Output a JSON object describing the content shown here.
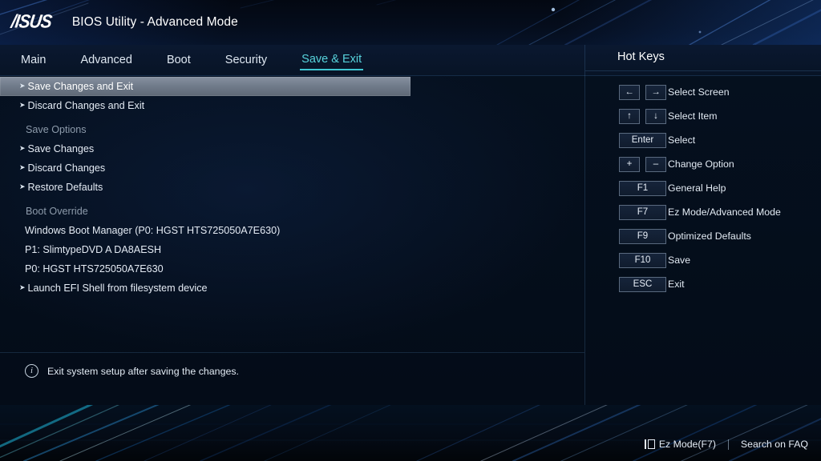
{
  "header": {
    "logo": "/ISUS",
    "title": "BIOS Utility - Advanced Mode"
  },
  "nav": {
    "items": [
      {
        "label": "Main",
        "active": false
      },
      {
        "label": "Advanced",
        "active": false
      },
      {
        "label": "Boot",
        "active": false
      },
      {
        "label": "Security",
        "active": false
      },
      {
        "label": "Save & Exit",
        "active": true
      }
    ]
  },
  "menu": {
    "rows": [
      {
        "label": "Save Changes and Exit",
        "type": "arrow",
        "selected": true
      },
      {
        "label": "Discard Changes and Exit",
        "type": "arrow",
        "selected": false
      },
      {
        "label": "Save Options",
        "type": "section",
        "selected": false
      },
      {
        "label": "Save Changes",
        "type": "arrow",
        "selected": false
      },
      {
        "label": "Discard Changes",
        "type": "arrow",
        "selected": false
      },
      {
        "label": "Restore Defaults",
        "type": "arrow",
        "selected": false
      },
      {
        "label": "Boot Override",
        "type": "section",
        "selected": false
      },
      {
        "label": "Windows Boot Manager (P0: HGST HTS725050A7E630)",
        "type": "plain",
        "selected": false
      },
      {
        "label": "P1: SlimtypeDVD A  DA8AESH",
        "type": "plain",
        "selected": false
      },
      {
        "label": "P0: HGST HTS725050A7E630",
        "type": "plain",
        "selected": false
      },
      {
        "label": "Launch EFI Shell from filesystem device",
        "type": "arrow",
        "selected": false
      }
    ],
    "arrow_glyph": "➤"
  },
  "help": {
    "icon": "info-icon",
    "icon_glyph": "i",
    "text": "Exit system setup after saving the changes."
  },
  "hotkeys": {
    "title": "Hot Keys",
    "rows": [
      {
        "keys": [
          "←",
          "→"
        ],
        "style": "sq",
        "label": "Select Screen"
      },
      {
        "keys": [
          "↑",
          "↓"
        ],
        "style": "sq",
        "label": "Select Item"
      },
      {
        "keys": [
          "Enter"
        ],
        "style": "wide",
        "label": "Select"
      },
      {
        "keys": [
          "+",
          "–"
        ],
        "style": "sq",
        "label": "Change Option"
      },
      {
        "keys": [
          "F1"
        ],
        "style": "wide",
        "label": "General Help"
      },
      {
        "keys": [
          "F7"
        ],
        "style": "wide",
        "label": "Ez Mode/Advanced Mode"
      },
      {
        "keys": [
          "F9"
        ],
        "style": "wide",
        "label": "Optimized Defaults"
      },
      {
        "keys": [
          "F10"
        ],
        "style": "wide",
        "label": "Save"
      },
      {
        "keys": [
          "ESC"
        ],
        "style": "wide",
        "label": "Exit"
      }
    ]
  },
  "footer": {
    "ez_mode_label": "Ez Mode(F7)",
    "search_faq_label": "Search on FAQ"
  },
  "colors": {
    "accent_cyan": "#57d3dc",
    "selection": "#707b8a",
    "panel_bg": "#05101f",
    "text": "#e4ebf4",
    "muted_text": "#8d9bab"
  }
}
